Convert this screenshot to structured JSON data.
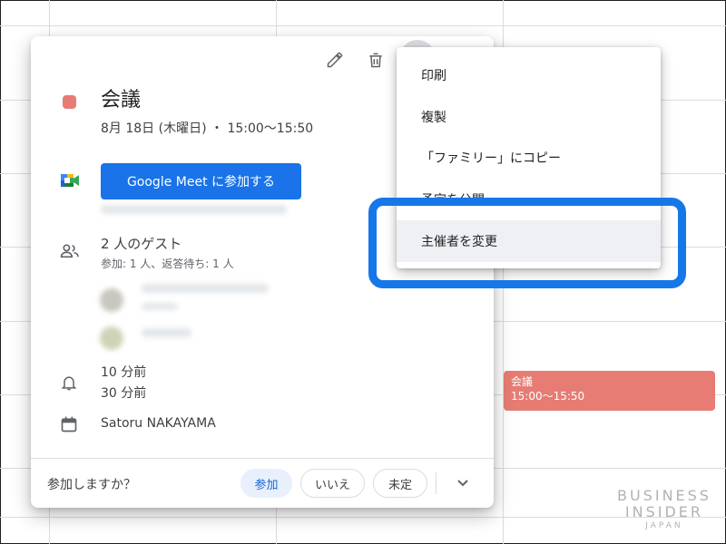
{
  "event_card": {
    "title": "会議",
    "datetime": "8月 18日 (木曜日) ・ 15:00～15:50",
    "meet_button": "Google Meet に参加する",
    "guests_count": "2 人のゲスト",
    "guests_summary": "参加: 1 人、返答待ち: 1 人",
    "reminders": [
      "10 分前",
      "30 分前"
    ],
    "organizer": "Satoru NAKAYAMA",
    "color": "#e67c73"
  },
  "rsvp": {
    "question": "参加しますか？",
    "options": [
      "参加",
      "いいえ",
      "未定"
    ],
    "selected": "参加"
  },
  "menu": {
    "items": [
      "印刷",
      "複製",
      "「ファミリー」にコピー",
      "予定を公開",
      "主催者を変更"
    ],
    "highlighted": "主催者を変更"
  },
  "calendar_event": {
    "title": "会議",
    "time": "15:00～15:50"
  },
  "watermark": {
    "line1": "BUSINESS",
    "line2": "INSIDER",
    "line3": "JAPAN"
  },
  "colors": {
    "accent": "#1a73e8",
    "event": "#e67c73",
    "annotation": "#1677e8"
  }
}
